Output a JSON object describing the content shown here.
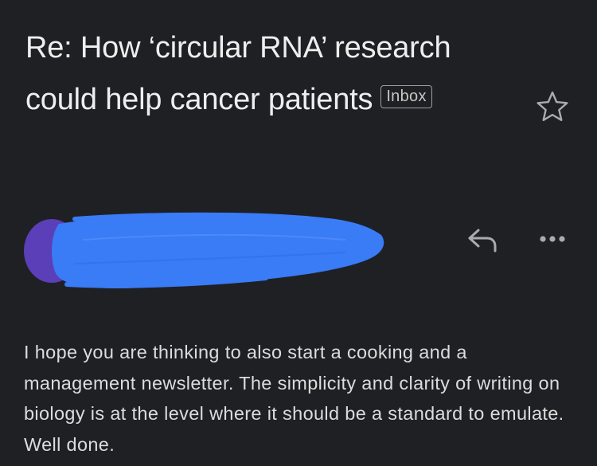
{
  "email": {
    "subject": "Re: How ‘circular RNA’ research could help cancer patients",
    "label_badge": "Inbox",
    "body": "I hope you are thinking to also start a cooking and a management newsletter. The simplicity and clarity of writing on biology is at the level where it should be a standard to emulate. Well done."
  },
  "icons": {
    "star": "star-outline-icon",
    "reply": "reply-arrow-icon",
    "more": "more-horizontal-icon"
  },
  "colors": {
    "background": "#1f2024",
    "text_primary": "#eeeeee",
    "text_body": "#dcdcdc",
    "icon": "#a8abb0",
    "avatar": "#5b3fb8",
    "redaction": "#3a7bf6"
  }
}
